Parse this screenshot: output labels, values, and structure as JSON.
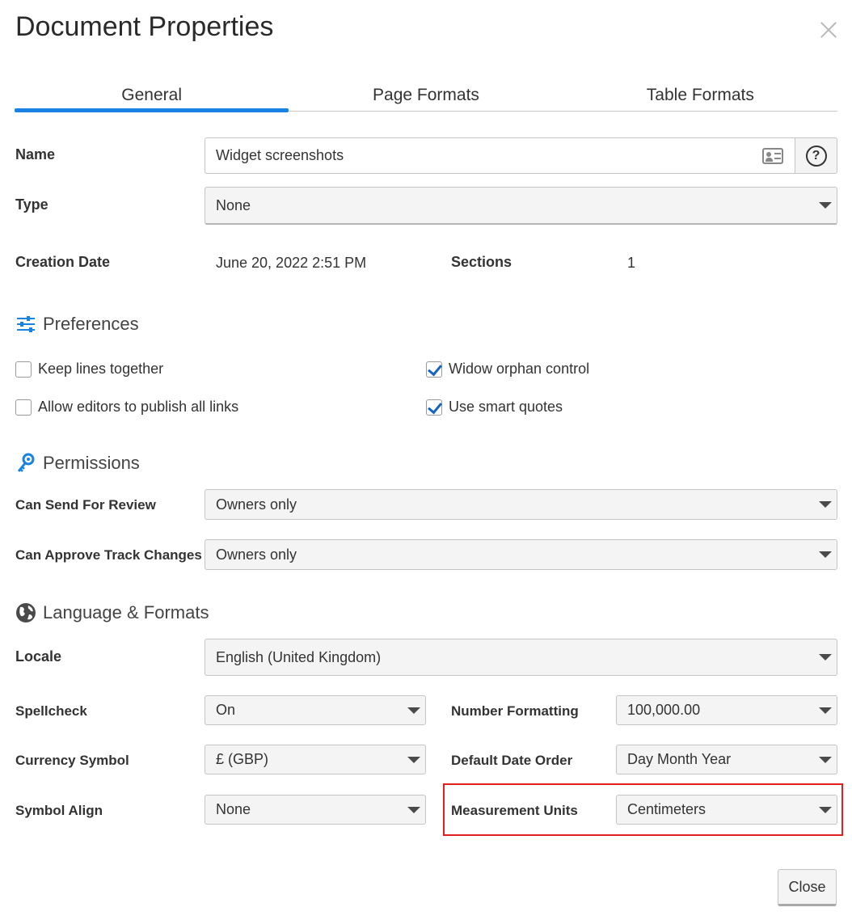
{
  "dialog": {
    "title": "Document Properties"
  },
  "tabs": [
    {
      "label": "General",
      "active": true
    },
    {
      "label": "Page Formats",
      "active": false
    },
    {
      "label": "Table Formats",
      "active": false
    }
  ],
  "general": {
    "name_label": "Name",
    "name_value": "Widget screenshots",
    "name_help": "?",
    "type_label": "Type",
    "type_value": "None",
    "creation_date_label": "Creation Date",
    "creation_date_value": "June 20, 2022 2:51 PM",
    "sections_label": "Sections",
    "sections_value": "1"
  },
  "preferences": {
    "heading": "Preferences",
    "options": [
      {
        "label": "Keep lines together",
        "checked": false
      },
      {
        "label": "Widow orphan control",
        "checked": true
      },
      {
        "label": "Allow editors to publish all links",
        "checked": false
      },
      {
        "label": "Use smart quotes",
        "checked": true
      }
    ]
  },
  "permissions": {
    "heading": "Permissions",
    "send_review_label": "Can Send For Review",
    "send_review_value": "Owners only",
    "approve_label": "Can Approve Track Changes",
    "approve_value": "Owners only"
  },
  "language": {
    "heading": "Language & Formats",
    "locale_label": "Locale",
    "locale_value": "English (United Kingdom)",
    "spellcheck_label": "Spellcheck",
    "spellcheck_value": "On",
    "number_format_label": "Number Formatting",
    "number_format_value": "100,000.00",
    "currency_label": "Currency Symbol",
    "currency_value": "£ (GBP)",
    "date_order_label": "Default Date Order",
    "date_order_value": "Day Month Year",
    "symbol_align_label": "Symbol Align",
    "symbol_align_value": "None",
    "measurement_label": "Measurement Units",
    "measurement_value": "Centimeters"
  },
  "footer": {
    "close_label": "Close"
  },
  "colors": {
    "accent": "#1a82e2",
    "highlight": "#e02020",
    "check": "#1565c0"
  },
  "icons": {
    "preferences": "sliders-icon",
    "permissions": "key-icon",
    "language": "globe-icon",
    "name_field": "contact-card-icon",
    "help": "question-circle-icon",
    "dismiss": "close-icon"
  }
}
